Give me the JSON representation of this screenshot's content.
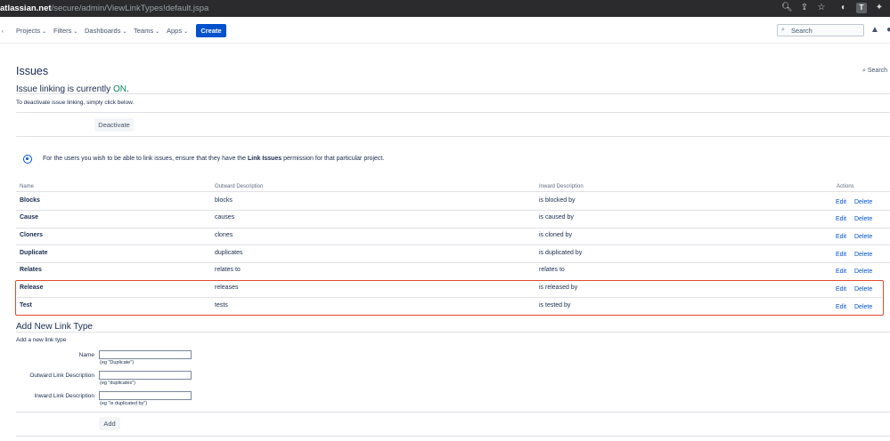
{
  "browser": {
    "url_host": "atlassian.net",
    "url_path": "/secure/admin/ViewLinkTypes!default.jspa",
    "ext_label": "T"
  },
  "nav": {
    "items": [
      {
        "label": "Projects"
      },
      {
        "label": "Filters"
      },
      {
        "label": "Dashboards"
      },
      {
        "label": "Teams"
      },
      {
        "label": "Apps"
      }
    ],
    "create_label": "Create",
    "search_placeholder": "Search"
  },
  "page": {
    "title": "Issues",
    "top_search": "Search",
    "linking_status_prefix": "Issue linking is currently",
    "linking_status_value": "ON",
    "deactivate_text": "To deactivate issue linking, simply click below.",
    "deactivate_button": "Deactivate",
    "info_prefix": "For the users you wish to be able to link issues, ensure that they have the",
    "info_bold": "Link Issues",
    "info_suffix": "permission for that particular project."
  },
  "table": {
    "headers": [
      "Name",
      "Outward Description",
      "Inward Description",
      "Actions"
    ],
    "rows": [
      {
        "name": "Blocks",
        "outward": "blocks",
        "inward": "is blocked by",
        "edit": "Edit",
        "delete": "Delete"
      },
      {
        "name": "Cause",
        "outward": "causes",
        "inward": "is caused by",
        "edit": "Edit",
        "delete": "Delete"
      },
      {
        "name": "Cloners",
        "outward": "clones",
        "inward": "is cloned by",
        "edit": "Edit",
        "delete": "Delete"
      },
      {
        "name": "Duplicate",
        "outward": "duplicates",
        "inward": "is duplicated by",
        "edit": "Edit",
        "delete": "Delete"
      },
      {
        "name": "Relates",
        "outward": "relates to",
        "inward": "relates to",
        "edit": "Edit",
        "delete": "Delete"
      },
      {
        "name": "Release",
        "outward": "releases",
        "inward": "is released by",
        "edit": "Edit",
        "delete": "Delete"
      },
      {
        "name": "Test",
        "outward": "tests",
        "inward": "is tested by",
        "edit": "Edit",
        "delete": "Delete"
      }
    ]
  },
  "add_form": {
    "title": "Add New Link Type",
    "subtitle": "Add a new link type",
    "name_label": "Name",
    "name_hint": "(eg \"Duplicate\")",
    "outward_label": "Outward Link Description",
    "outward_hint": "(eg \"duplicates\")",
    "inward_label": "Inward Link Description",
    "inward_hint": "(eg \"is duplicated by\")",
    "add_button": "Add"
  },
  "colors": {
    "accent": "#0052cc",
    "status_on": "#00875a",
    "highlight": "#e34b2f"
  }
}
